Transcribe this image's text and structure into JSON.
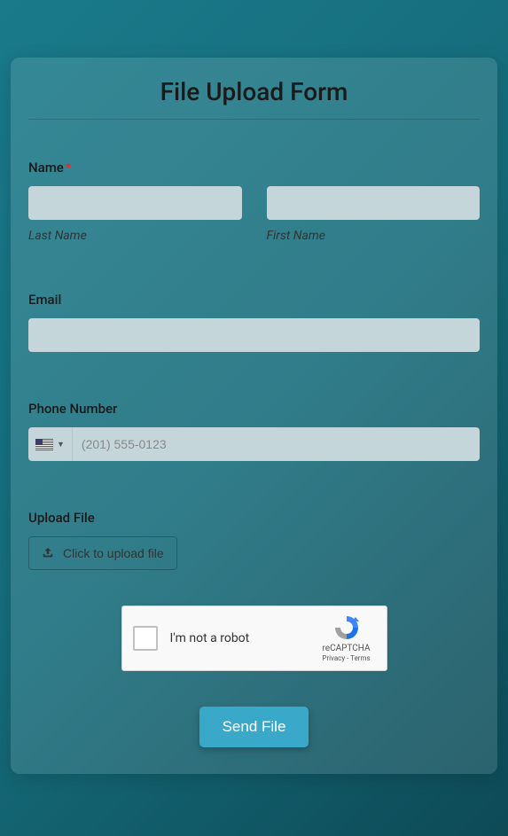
{
  "title": "File Upload Form",
  "name": {
    "label": "Name",
    "required": true,
    "last_sub": "Last Name",
    "first_sub": "First Name"
  },
  "email": {
    "label": "Email"
  },
  "phone": {
    "label": "Phone Number",
    "placeholder": "(201) 555-0123",
    "country": "US"
  },
  "upload": {
    "label": "Upload File",
    "button": "Click to upload file"
  },
  "recaptcha": {
    "label": "I'm not a robot",
    "brand": "reCAPTCHA",
    "links": "Privacy - Terms"
  },
  "submit": "Send File"
}
